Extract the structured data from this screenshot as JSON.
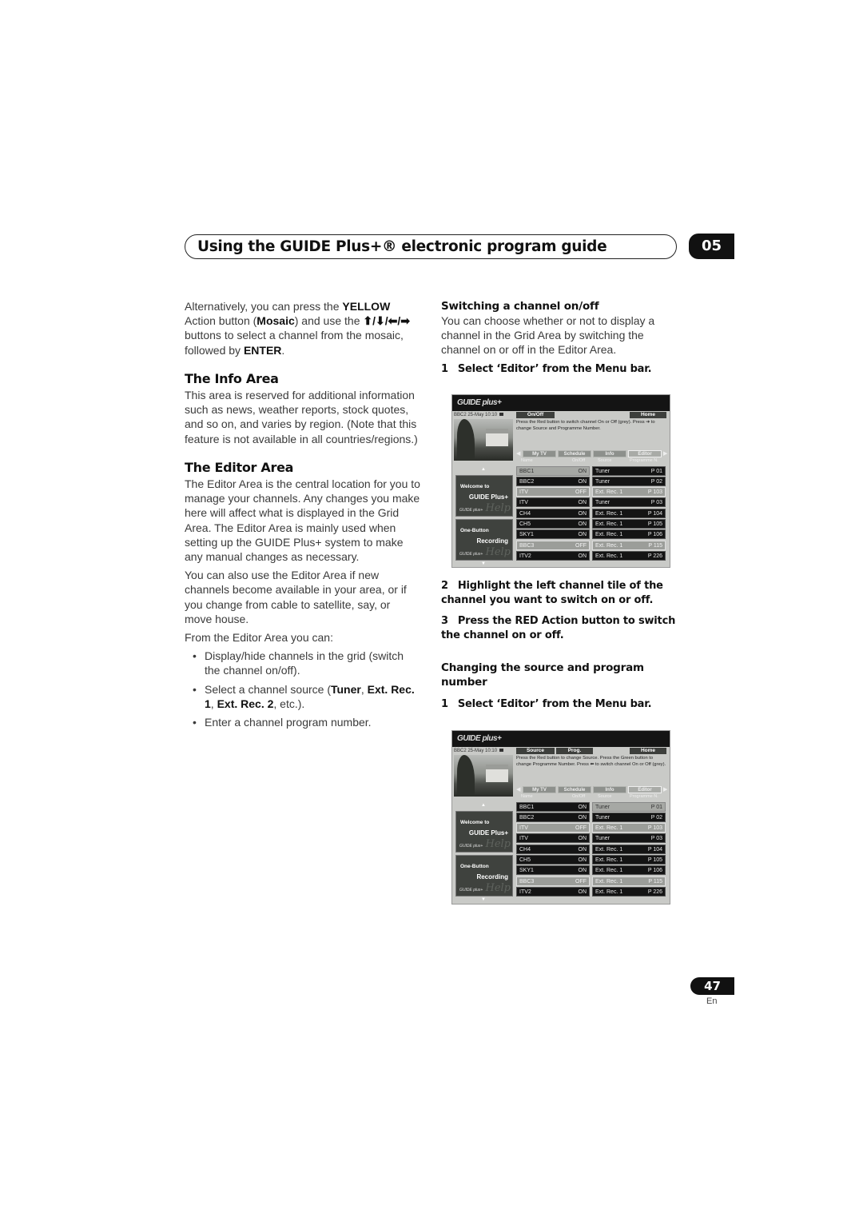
{
  "header": {
    "title": "Using the GUIDE Plus+® electronic program guide",
    "chapter": "05"
  },
  "left_column": {
    "intro": {
      "t1": "Alternatively, you can press the ",
      "b1": "YELLOW",
      "t2": " Action button (",
      "b2": "Mosaic",
      "t3": ") and use the ",
      "arrows": "⬆/⬇/⬅/➡",
      "t4": " buttons to select a channel from the mosaic, followed by ",
      "b3": "ENTER",
      "t5": "."
    },
    "info_area": {
      "heading": "The Info Area",
      "body": "This area is reserved for additional information such as news, weather reports, stock quotes, and so on, and varies by region. (Note that this feature is not available in all countries/regions.)"
    },
    "editor_area": {
      "heading": "The Editor Area",
      "p1": "The Editor Area is the central location for you to manage your channels. Any changes you make here will affect what is displayed in the Grid Area. The Editor Area is mainly used when setting up the GUIDE Plus+ system to make any manual changes as necessary.",
      "p2": "You can also use the Editor Area if new channels become available in your area, or if you change from cable to satellite, say, or move house.",
      "p3": "From the Editor Area you can:",
      "bullet1": "Display/hide channels in the grid (switch the channel on/off).",
      "bullet2": {
        "t1": "Select a channel source (",
        "b1": "Tuner",
        "t2": ", ",
        "b2": "Ext. Rec. 1",
        "t3": ", ",
        "b3": "Ext. Rec. 2",
        "t4": ", etc.)."
      },
      "bullet3": "Enter a channel program number."
    }
  },
  "right_column": {
    "switching": {
      "heading": "Switching a channel on/off",
      "body": "You can choose whether or not to display a channel in the Grid Area by switching the channel on or off in the Editor Area.",
      "step1_num": "1",
      "step1": "Select ‘Editor’ from the Menu bar.",
      "step2_num": "2",
      "step2": "Highlight the left channel tile of the channel you want to switch on or off.",
      "step3_num": "3",
      "step3": "Press the RED Action button to switch the channel on or off."
    },
    "changing": {
      "heading": "Changing the source and program number",
      "step1_num": "1",
      "step1": "Select ‘Editor’ from the Menu bar."
    }
  },
  "screen1": {
    "logo": "GUIDE plus+",
    "status": "BBC2   25-May  10:10",
    "buttons": [
      "On/Off"
    ],
    "home": "Home",
    "message": "Press the Red button to switch channel On or Off (grey). Press ➔ to change Source and Programme Number.",
    "tabs": [
      "My TV",
      "Schedule",
      "Info",
      "Editor"
    ],
    "columns": [
      "Name",
      "On/Off",
      "Source",
      "Programme N."
    ],
    "side_panels": [
      {
        "line1": "Welcome to",
        "line2": "GUIDE Plus+",
        "help": "Help",
        "mini": "GUIDE plus+"
      },
      {
        "line1": "One-Button",
        "line2": "Recording",
        "help": "Help",
        "mini": "GUIDE plus+"
      }
    ],
    "rows": [
      {
        "name": "BBC1",
        "state": "ON",
        "source": "Tuner",
        "prog": "P  01",
        "name_style": "hl",
        "src_style": ""
      },
      {
        "name": "BBC2",
        "state": "ON",
        "source": "Tuner",
        "prog": "P  02",
        "name_style": "",
        "src_style": ""
      },
      {
        "name": "ITV",
        "state": "OFF",
        "source": "Ext. Rec. 1",
        "prog": "P 103",
        "name_style": "off",
        "src_style": "off"
      },
      {
        "name": "ITV",
        "state": "ON",
        "source": "Tuner",
        "prog": "P  03",
        "name_style": "",
        "src_style": ""
      },
      {
        "name": "CH4",
        "state": "ON",
        "source": "Ext. Rec. 1",
        "prog": "P 104",
        "name_style": "",
        "src_style": ""
      },
      {
        "name": "CH5",
        "state": "ON",
        "source": "Ext. Rec. 1",
        "prog": "P 105",
        "name_style": "",
        "src_style": ""
      },
      {
        "name": "SKY1",
        "state": "ON",
        "source": "Ext. Rec. 1",
        "prog": "P 106",
        "name_style": "",
        "src_style": ""
      },
      {
        "name": "BBC3",
        "state": "OFF",
        "source": "Ext. Rec. 1",
        "prog": "P 115",
        "name_style": "off",
        "src_style": "off"
      },
      {
        "name": "ITV2",
        "state": "ON",
        "source": "Ext. Rec. 1",
        "prog": "P 226",
        "name_style": "",
        "src_style": ""
      }
    ]
  },
  "screen2": {
    "logo": "GUIDE plus+",
    "status": "BBC2   25-May  10:10",
    "buttons": [
      "Source",
      "Prog."
    ],
    "home": "Home",
    "message": "Press the Red button to change Source. Press the Green button to change Programme Number. Press ⬅ to switch channel On or Off (grey).",
    "tabs": [
      "My TV",
      "Schedule",
      "Info",
      "Editor"
    ],
    "columns": [
      "Name",
      "On/Off",
      "Source",
      "Programme N."
    ],
    "side_panels": [
      {
        "line1": "Welcome to",
        "line2": "GUIDE Plus+",
        "help": "Help",
        "mini": "GUIDE plus+"
      },
      {
        "line1": "One-Button",
        "line2": "Recording",
        "help": "Help",
        "mini": "GUIDE plus+"
      }
    ],
    "rows": [
      {
        "name": "BBC1",
        "state": "ON",
        "source": "Tuner",
        "prog": "P  01",
        "name_style": "",
        "src_style": "hl"
      },
      {
        "name": "BBC2",
        "state": "ON",
        "source": "Tuner",
        "prog": "P  02",
        "name_style": "",
        "src_style": ""
      },
      {
        "name": "ITV",
        "state": "OFF",
        "source": "Ext. Rec. 1",
        "prog": "P 103",
        "name_style": "off",
        "src_style": "off"
      },
      {
        "name": "ITV",
        "state": "ON",
        "source": "Tuner",
        "prog": "P  03",
        "name_style": "",
        "src_style": ""
      },
      {
        "name": "CH4",
        "state": "ON",
        "source": "Ext. Rec. 1",
        "prog": "P 104",
        "name_style": "",
        "src_style": ""
      },
      {
        "name": "CH5",
        "state": "ON",
        "source": "Ext. Rec. 1",
        "prog": "P 105",
        "name_style": "",
        "src_style": ""
      },
      {
        "name": "SKY1",
        "state": "ON",
        "source": "Ext. Rec. 1",
        "prog": "P 106",
        "name_style": "",
        "src_style": ""
      },
      {
        "name": "BBC3",
        "state": "OFF",
        "source": "Ext. Rec. 1",
        "prog": "P 115",
        "name_style": "off",
        "src_style": "off"
      },
      {
        "name": "ITV2",
        "state": "ON",
        "source": "Ext. Rec. 1",
        "prog": "P 226",
        "name_style": "",
        "src_style": ""
      }
    ]
  },
  "footer": {
    "page_number": "47",
    "language": "En"
  }
}
